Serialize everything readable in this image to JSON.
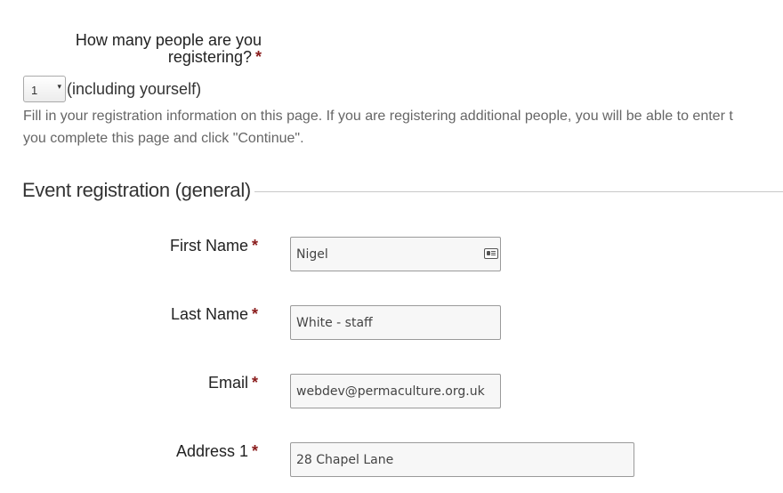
{
  "people": {
    "question": "How many people are you registering?",
    "required_mark": "*",
    "selected_count": "1",
    "dropdown_arrow": "▾",
    "suffix": "(including yourself)"
  },
  "help": {
    "line1": "Fill in your registration information on this page. If you are registering additional people, you will be able to enter t",
    "line2": "you complete this page and click \"Continue\"."
  },
  "section": {
    "title": "Event registration (general)"
  },
  "fields": {
    "first_name": {
      "label": "First Name",
      "required_mark": "*",
      "value": "Nigel",
      "icon": "contact-card-icon"
    },
    "last_name": {
      "label": "Last Name",
      "required_mark": "*",
      "value": "White - staff"
    },
    "email": {
      "label": "Email",
      "required_mark": "*",
      "value": "webdev@permaculture.org.uk"
    },
    "address1": {
      "label": "Address 1",
      "required_mark": "*",
      "value": "28 Chapel Lane"
    }
  },
  "colors": {
    "required": "#8a1c1c",
    "help_text": "#666666",
    "input_border": "#9a9a9a",
    "input_bg": "#f7f7f7"
  }
}
